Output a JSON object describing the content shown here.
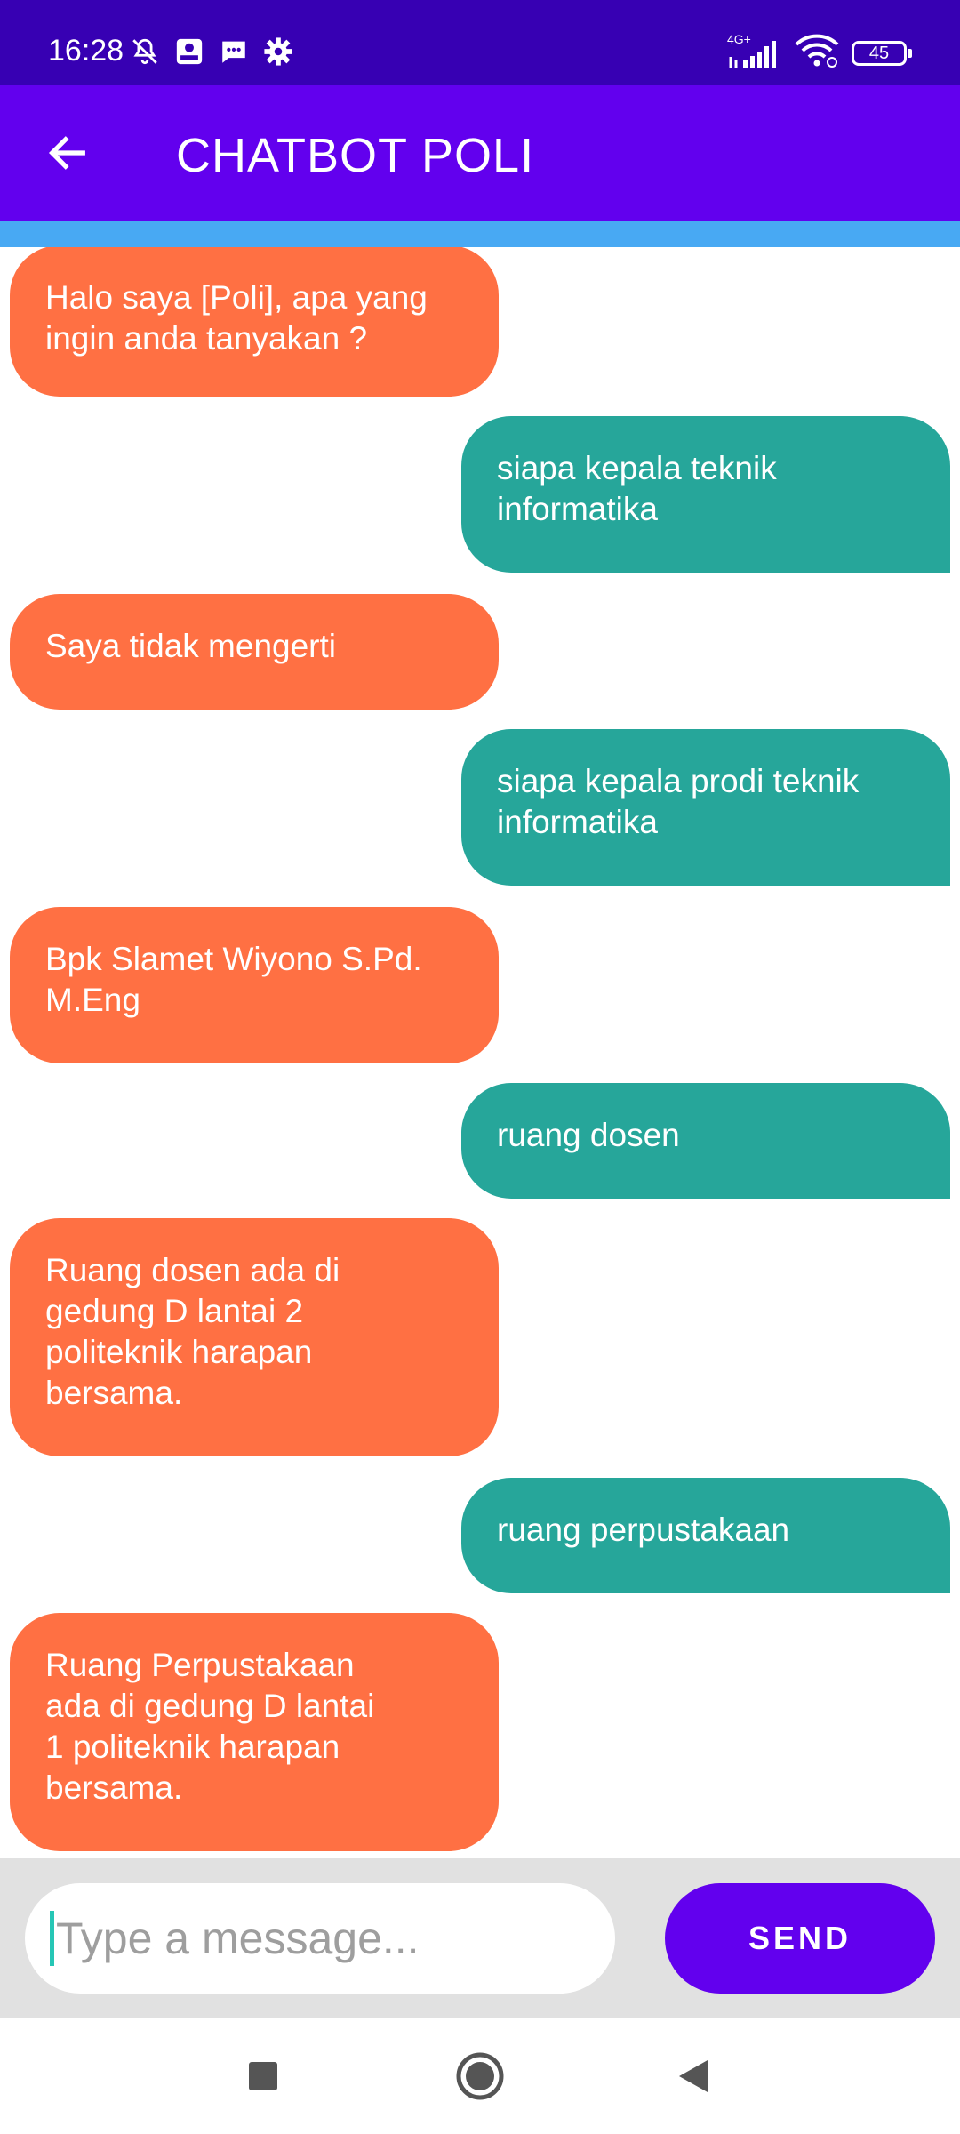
{
  "status_bar": {
    "time": "16:28",
    "network": "4G+",
    "battery_level": "45",
    "icons_left": [
      "notifications-off-icon",
      "tiket-app-icon",
      "messages-icon",
      "settings-gear-icon"
    ],
    "icons_right": [
      "signal-icon",
      "wifi-icon",
      "battery-icon"
    ]
  },
  "app_bar": {
    "title": "CHATBOT POLI",
    "back_icon": "arrow-left-icon",
    "color": "#6200ee"
  },
  "colors": {
    "status_bar": "#3700b3",
    "accent_strip": "#48a9f3",
    "bot_bubble": "#ff7043",
    "user_bubble": "#26a69a",
    "send_button": "#6200ee"
  },
  "messages": [
    {
      "sender": "bot",
      "text": "Halo saya [Poli], apa yang\ningin anda tanyakan ?"
    },
    {
      "sender": "user",
      "text": "siapa kepala teknik\ninformatika"
    },
    {
      "sender": "bot",
      "text": "Saya tidak mengerti"
    },
    {
      "sender": "user",
      "text": "siapa kepala prodi teknik\ninformatika"
    },
    {
      "sender": "bot",
      "text": "Bpk Slamet Wiyono S.Pd.\nM.Eng"
    },
    {
      "sender": "user",
      "text": "ruang dosen"
    },
    {
      "sender": "bot",
      "text": "Ruang dosen ada di\ngedung D lantai 2\npoliteknik harapan\nbersama."
    },
    {
      "sender": "user",
      "text": "ruang perpustakaan"
    },
    {
      "sender": "bot",
      "text": "Ruang Perpustakaan\nada di gedung D lantai\n1 politeknik harapan\nbersama."
    }
  ],
  "input": {
    "placeholder": "Type a message...",
    "value": ""
  },
  "send_label": "SEND",
  "nav_bar": {
    "buttons": [
      "recents-square-icon",
      "home-circle-icon",
      "back-triangle-icon"
    ]
  }
}
